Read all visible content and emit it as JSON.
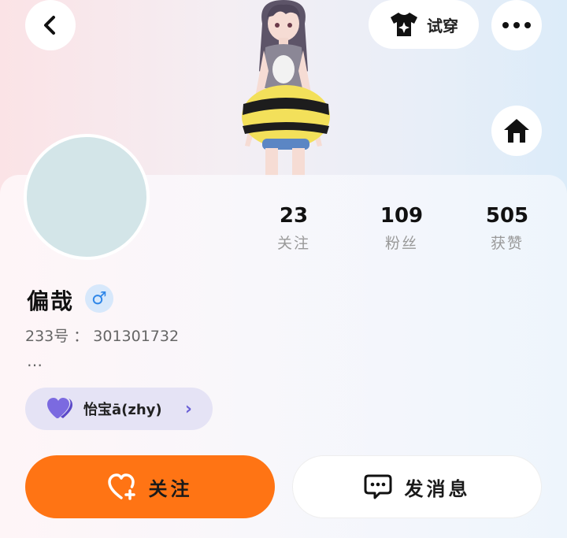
{
  "header": {
    "tryon_label": "试穿",
    "icons": [
      "back-chevron-icon",
      "tshirt-sparkle-icon",
      "more-dots-icon",
      "home-icon"
    ]
  },
  "profile": {
    "name": "偏哉",
    "gender": "♂",
    "uid_label": "233号",
    "uid_separator": "：",
    "uid_value": "301301732",
    "bio": "…"
  },
  "stats": {
    "following": {
      "value": "23",
      "label": "关注"
    },
    "fans": {
      "value": "109",
      "label": "粉丝"
    },
    "likes": {
      "value": "505",
      "label": "获赞"
    }
  },
  "relation": {
    "text": "怡宝ā(zhy)",
    "icon": "heart-icon",
    "chevron": "›"
  },
  "actions": {
    "follow_label": "关注",
    "message_label": "发消息"
  },
  "colors": {
    "accent_orange": "#ff7414",
    "relation_purple": "#7b6ae0",
    "gender_blue": "#2e86e8"
  }
}
